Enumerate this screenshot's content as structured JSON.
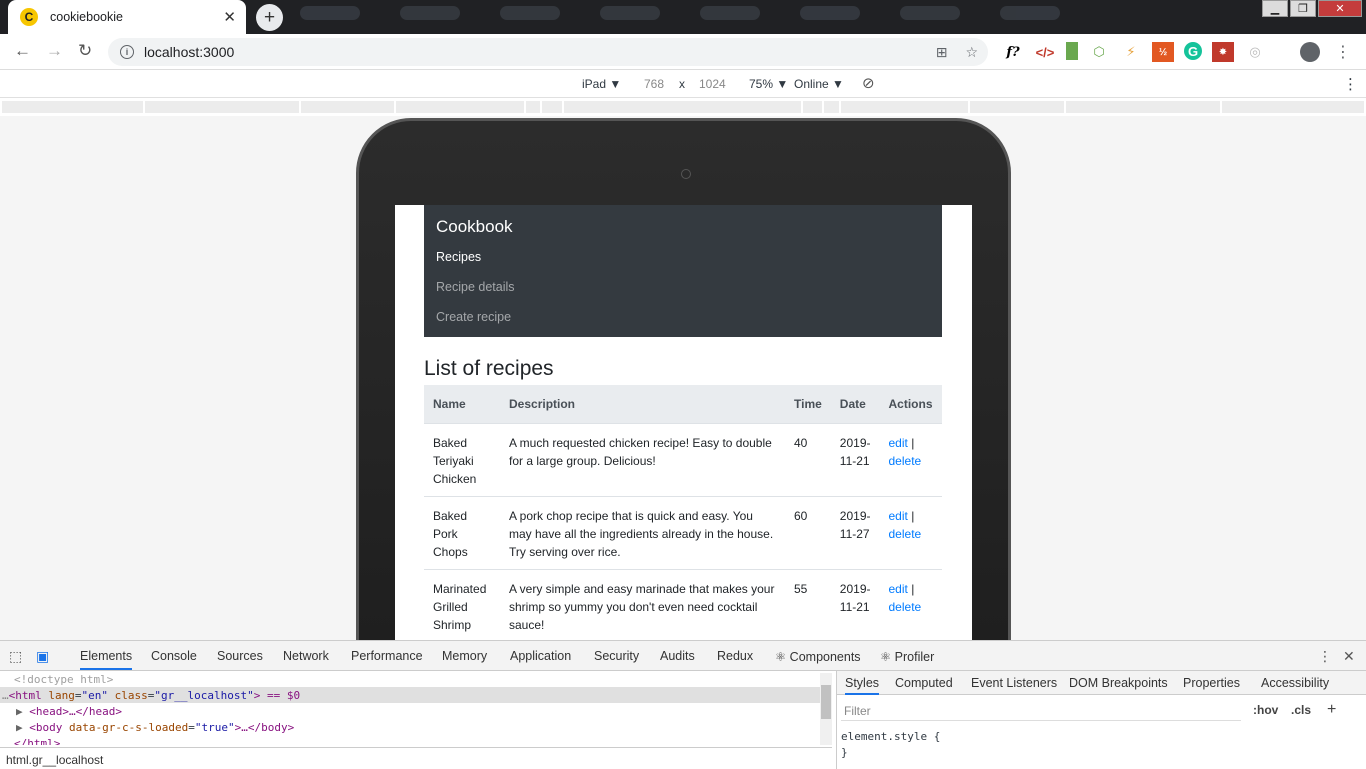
{
  "browser": {
    "tab_title": "cookiebookie",
    "favicon_letter": "C",
    "tab_close": "✕",
    "new_tab": "+",
    "url": "localhost:3000"
  },
  "device_toolbar": {
    "device": "iPad ▼",
    "width": "768",
    "times": "x",
    "height": "1024",
    "zoom": "75% ▼",
    "network": "Online ▼"
  },
  "app": {
    "brand": "Cookbook",
    "nav": [
      {
        "label": "Recipes"
      },
      {
        "label": "Recipe details"
      },
      {
        "label": "Create recipe"
      }
    ],
    "heading": "List of recipes",
    "columns": [
      "Name",
      "Description",
      "Time",
      "Date",
      "Actions"
    ],
    "rows": [
      {
        "name": "Baked Teriyaki Chicken",
        "description": "A much requested chicken recipe! Easy to double for a large group. Delicious!",
        "time": "40",
        "date": "2019-11-21"
      },
      {
        "name": "Baked Pork Chops",
        "description": "A pork chop recipe that is quick and easy. You may have all the ingredients already in the house. Try serving over rice.",
        "time": "60",
        "date": "2019-11-27"
      },
      {
        "name": "Marinated Grilled Shrimp",
        "description": "A very simple and easy marinade that makes your shrimp so yummy you don't even need cocktail sauce!",
        "time": "55",
        "date": "2019-11-21"
      }
    ],
    "action_edit": "edit",
    "action_sep": " |",
    "action_delete": "delete"
  },
  "devtools": {
    "tabs": [
      "Elements",
      "Console",
      "Sources",
      "Network",
      "Performance",
      "Memory",
      "Application",
      "Security",
      "Audits",
      "Redux",
      "⚛ Components",
      "⚛ Profiler"
    ],
    "dom_lines": {
      "doctype": "<!doctype html>",
      "html_open": "<html",
      "lang_attr": "lang",
      "lang_val": "\"en\"",
      "class_attr": "class",
      "class_val": "\"gr__localhost\"",
      "html_end": "> == $0",
      "head": "<head>…</head>",
      "body_open": "<body",
      "body_attr": "data-gr-c-s-loaded",
      "body_val": "\"true\"",
      "body_end": ">…</body>",
      "html_close": "</html>"
    },
    "breadcrumb": "html.gr__localhost",
    "side_tabs": [
      "Styles",
      "Computed",
      "Event Listeners",
      "DOM Breakpoints",
      "Properties",
      "Accessibility"
    ],
    "filter_placeholder": "Filter",
    "hov": ":hov",
    "cls": ".cls",
    "rule_selector": "element.style {",
    "rule_close": "}"
  }
}
